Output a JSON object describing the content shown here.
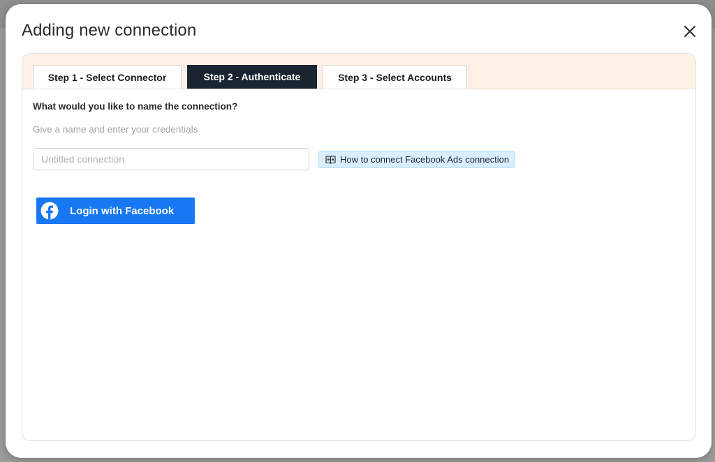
{
  "modal": {
    "title": "Adding new connection"
  },
  "steps": [
    {
      "label": "Step 1 - Select Connector",
      "active": false
    },
    {
      "label": "Step 2 - Authenticate",
      "active": true
    },
    {
      "label": "Step 3 - Select Accounts",
      "active": false
    }
  ],
  "form": {
    "question": "What would you like to name the connection?",
    "hint": "Give a name and enter your credentials",
    "name_placeholder": "Untitled connection",
    "name_value": ""
  },
  "help": {
    "label": "How to connect Facebook Ads connection",
    "icon": "book-icon"
  },
  "login": {
    "label": "Login with Facebook",
    "icon": "facebook-icon"
  },
  "colors": {
    "active_tab": "#1b2531",
    "header_band": "#fdf1e6",
    "facebook_blue": "#1877f2",
    "help_bg": "#d9efff"
  }
}
